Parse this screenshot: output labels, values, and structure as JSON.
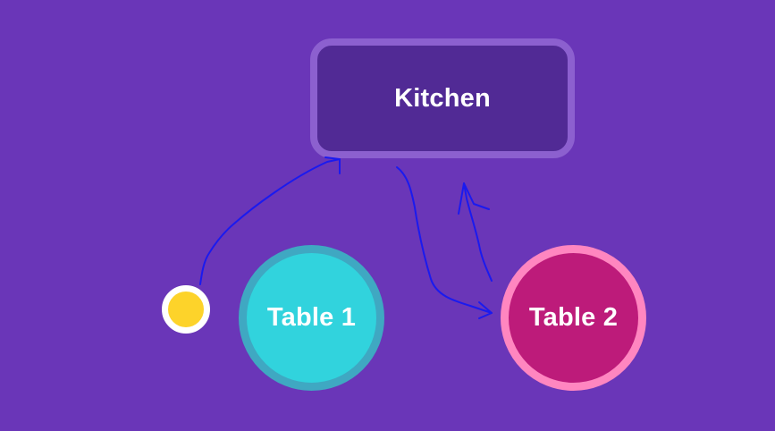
{
  "diagram": {
    "background_color": "#6a36b8",
    "kitchen": {
      "label": "Kitchen",
      "fill_color": "#512a95",
      "border_color": "#8c60cf"
    },
    "tables": [
      {
        "label": "Table 1",
        "fill_color": "#31d3dd",
        "border_color": "#3fa8c2"
      },
      {
        "label": "Table 2",
        "fill_color": "#bd1b7a",
        "border_color": "#ff86c0"
      }
    ],
    "token": {
      "color": "#fdd32a",
      "ring_color": "#ffffff"
    },
    "stroke_color": "#1a1aef"
  }
}
